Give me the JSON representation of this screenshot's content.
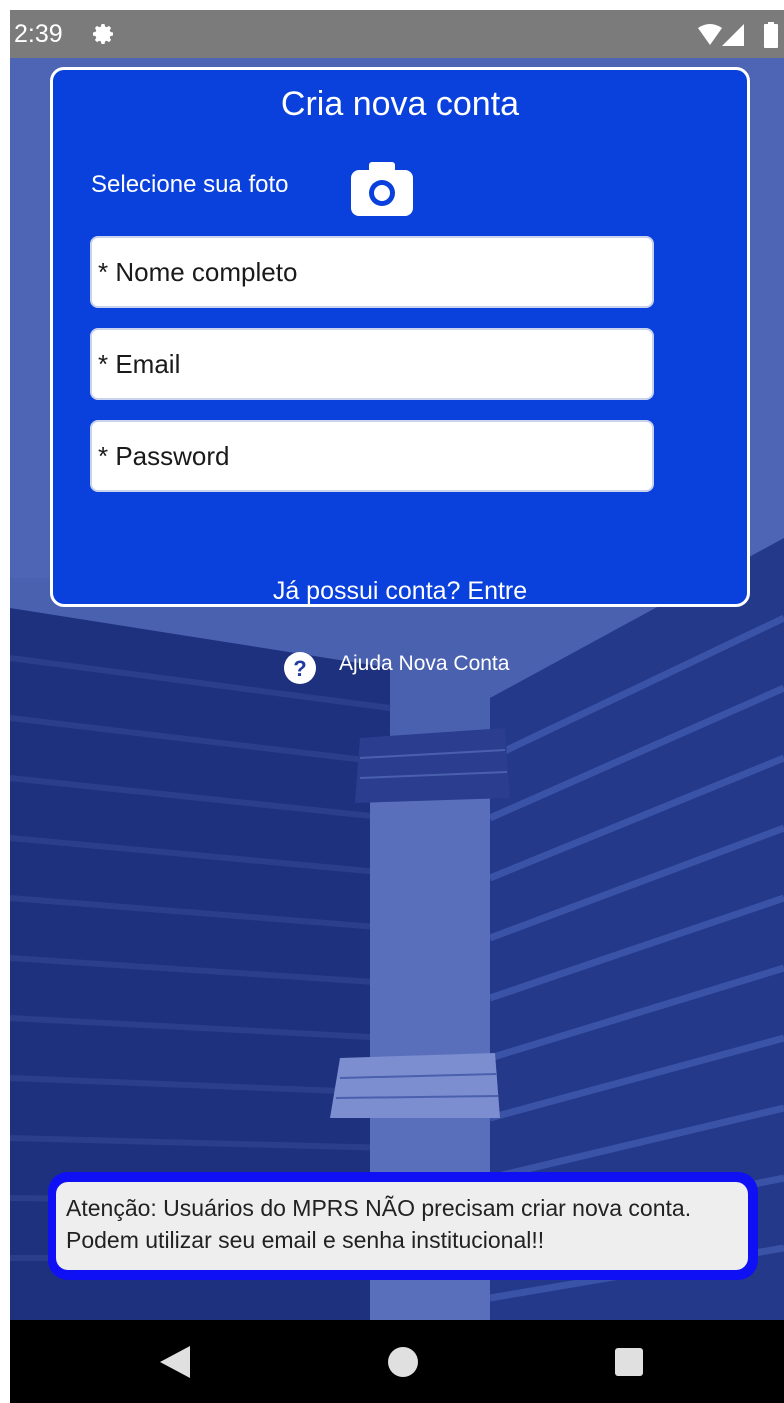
{
  "status_bar": {
    "time": "2:39",
    "icons": [
      "gear-icon",
      "wifi-icon",
      "signal-icon",
      "battery-icon"
    ]
  },
  "form": {
    "title": "Cria nova conta",
    "photo_label": "Selecione sua foto",
    "camera_icon": "camera-icon",
    "name_placeholder": "* Nome completo",
    "email_placeholder": "* Email",
    "password_placeholder": "* Password",
    "login_link": "Já possui conta? Entre"
  },
  "help": {
    "icon": "help-circle-icon",
    "label": "Ajuda Nova Conta"
  },
  "notice": {
    "text": "Atenção: Usuários do MPRS NÃO precisam criar nova conta. Podem utilizar seu email e senha institucional!!"
  },
  "nav_bar": {
    "icons": [
      "back-icon",
      "home-icon",
      "recents-icon"
    ]
  },
  "colors": {
    "card_background": "#0a41dc",
    "notice_border": "#1010f5",
    "page_background": "#3b4e9a"
  }
}
